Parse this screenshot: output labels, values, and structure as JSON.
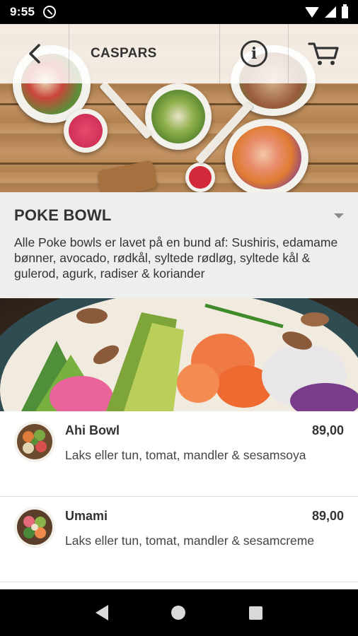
{
  "status_bar": {
    "time": "9:55",
    "icons": [
      "notification-app-icon",
      "wifi-icon",
      "signal-icon",
      "battery-icon"
    ]
  },
  "header": {
    "title": "CASPARS",
    "back_icon": "chevron-left-icon",
    "info_icon": "info-icon",
    "cart_icon": "cart-icon"
  },
  "category": {
    "title": "POKE BOWL",
    "description": "Alle Poke bowls er lavet på en bund af: Sushiris, edamame bønner, avocado, rødkål, syltede rødløg, syltede kål & gulerod, agurk, radiser & koriander",
    "toggle_icon": "dropdown-arrow-icon"
  },
  "products": [
    {
      "name": "Ahi Bowl",
      "price": "89,00",
      "description": "Laks eller tun, tomat, mandler & sesamsoya"
    },
    {
      "name": "Umami",
      "price": "89,00",
      "description": "Laks eller tun, tomat, mandler & sesamcreme"
    }
  ],
  "nav_bar": {
    "buttons": [
      "back-nav-icon",
      "home-nav-icon",
      "recents-nav-icon"
    ]
  },
  "colors": {
    "text_dark": "#333333",
    "category_bg": "#eeeeee",
    "divider": "#e0e0e0",
    "topbar_bg": "rgba(255,255,255,0.82)"
  }
}
